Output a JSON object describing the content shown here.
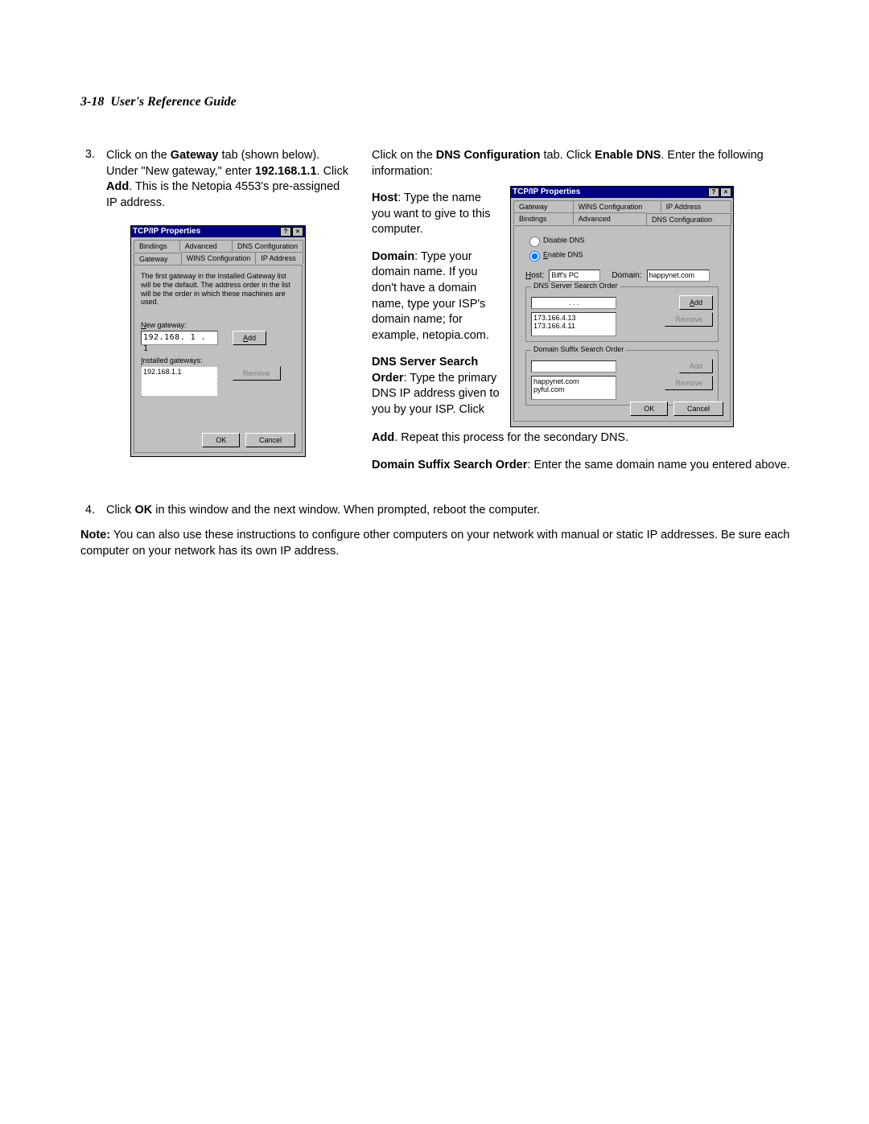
{
  "header": {
    "page_ref": "3-18",
    "title": "User's Reference Guide"
  },
  "step3": {
    "num": "3.",
    "t1": "Click on the ",
    "b1": "Gateway",
    "t2": " tab (shown below). Under \"New gateway,\" enter ",
    "b2": "192.168.1.1",
    "t3": ". Click ",
    "b3": "Add",
    "t4": ". This is the Netopia 4553's pre-assigned IP address."
  },
  "dlg1": {
    "title": "TCP/IP Properties",
    "help_btn": "?",
    "close_btn": "×",
    "tabs_row1": [
      "Bindings",
      "Advanced",
      "DNS Configuration"
    ],
    "tabs_row2": [
      "Gateway",
      "WINS Configuration",
      "IP Address"
    ],
    "active_tab": "Gateway",
    "helptext": "The first gateway in the Installed Gateway list will be the default. The address order in the list will be the order in which these machines are used.",
    "new_gw_label_pre": "N",
    "new_gw_label_post": "ew gateway:",
    "new_gw_value": "192.168. 1 . 1",
    "add_btn_pre": "A",
    "add_btn_post": "dd",
    "installed_label_pre": "I",
    "installed_label_post": "nstalled gateways:",
    "installed_value": "192.168.1.1",
    "remove_btn": "Remove",
    "ok_btn": "OK",
    "cancel_btn": "Cancel"
  },
  "right": {
    "para1_a": "Click on the ",
    "para1_b": "DNS Configuration",
    "para1_c": " tab. Click ",
    "para1_d": "Enable DNS",
    "para1_e": ". Enter the following information:",
    "host_b": "Host",
    "host_t": ": Type the name you want to give to this computer.",
    "dom_b": "Domain",
    "dom_t": ": Type your domain name. If you don't have a domain name, type your ISP's domain name; for example, netopia.com.",
    "dss_b": "DNS Server Search Order",
    "dss_t": ": Type the primary DNS IP address given to you by your ISP. Click ",
    "add_after_b": "Add",
    "add_after_t": ". Repeat this process for the secondary DNS.",
    "suf_b": "Domain Suffix Search Order",
    "suf_t": ": Enter the same domain name you entered above."
  },
  "dlg2": {
    "title": "TCP/IP Properties",
    "help_btn": "?",
    "close_btn": "×",
    "tabs_row1": [
      "Gateway",
      "WINS Configuration",
      "IP Address"
    ],
    "tabs_row2": [
      "Bindings",
      "Advanced",
      "DNS Configuration"
    ],
    "active_tab": "DNS Configuration",
    "radio_disable": "Disable DNS",
    "radio_enable_pre": "E",
    "radio_enable_post": "nable DNS",
    "host_label_pre": "H",
    "host_label_post": "ost:",
    "host_value": "Biff's PC",
    "domain_label": "Domain:",
    "domain_value": "happynet.com",
    "dns_order_label": "DNS Server Search Order",
    "dns_input": ".   .   .",
    "add_btn_pre": "A",
    "add_btn_post": "dd",
    "dns_list": "173.166.4.13\n173.166.4.11",
    "remove_btn": "Remove",
    "suffix_label": "Domain Suffix Search Order",
    "suffix_input": "",
    "suffix_add": "Add",
    "suffix_list": "happynet.com\npyful.com",
    "suffix_remove": "Remove",
    "ok_btn": "OK",
    "cancel_btn": "Cancel"
  },
  "step4": {
    "num": "4.",
    "t1": "Click ",
    "b1": "OK",
    "t2": " in this window and the next window. When prompted, reboot the computer."
  },
  "note": {
    "b": "Note:",
    "t": " You can also use these instructions to configure other computers on your network with manual or static IP addresses. Be sure each computer on your network has its own IP address."
  }
}
